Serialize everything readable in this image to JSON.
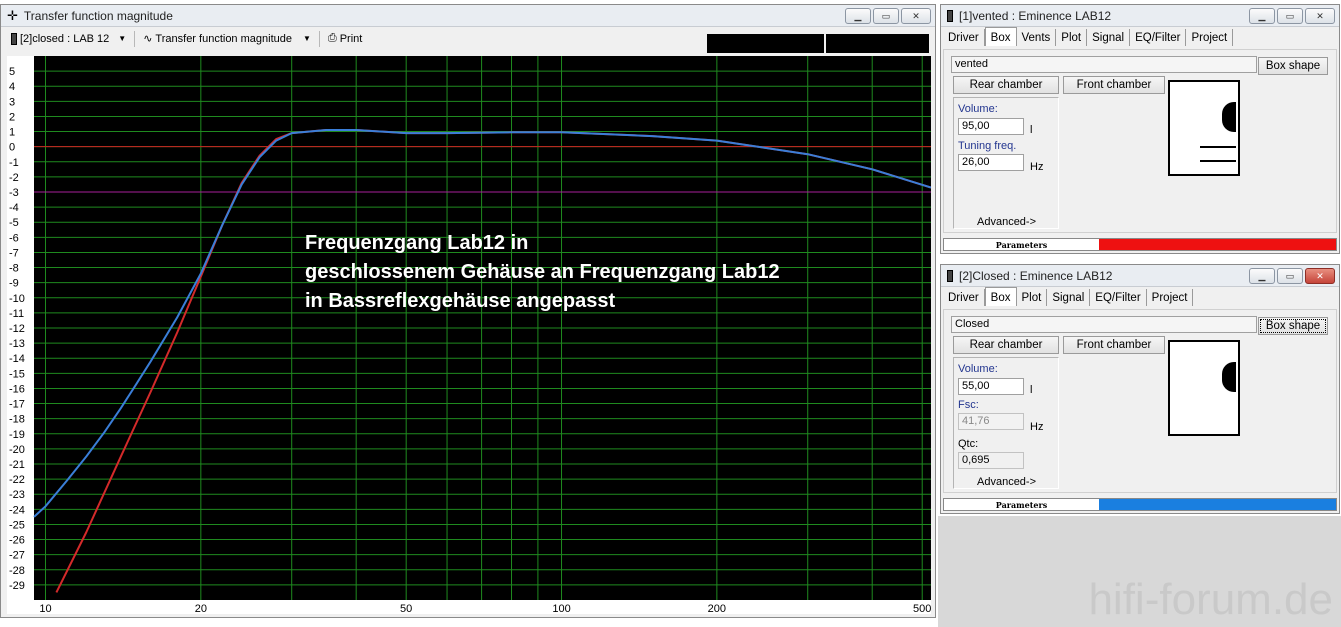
{
  "main_window": {
    "title": "Transfer function magnitude",
    "toolbar": {
      "driver_select": "[2]closed : LAB 12",
      "view_select": "Transfer function magnitude",
      "print_label": "Print"
    }
  },
  "chart_data": {
    "type": "line",
    "x_scale": "log",
    "xlim": [
      9.5,
      520
    ],
    "ylim": [
      -30,
      6
    ],
    "x_ticks": [
      "10",
      "20",
      "50",
      "100",
      "200",
      "500"
    ],
    "y_ticks": [
      "5",
      "4",
      "3",
      "2",
      "1",
      "0",
      "-1",
      "-2",
      "-3",
      "-4",
      "-5",
      "-6",
      "-7",
      "-8",
      "-9",
      "-10",
      "-11",
      "-12",
      "-13",
      "-14",
      "-15",
      "-16",
      "-17",
      "-18",
      "-19",
      "-20",
      "-21",
      "-22",
      "-23",
      "-24",
      "-25",
      "-26",
      "-27",
      "-28",
      "-29"
    ],
    "reference_lines": [
      0,
      -3
    ],
    "grid": true,
    "annotation": "Frequenzgang Lab12 in geschlossenem Gehäuse an Frequenzgang Lab12 in Bassreflexgehäuse angepasst",
    "series": [
      {
        "color": "#d42a2a",
        "x": [
          10.5,
          12,
          14,
          16,
          18,
          20,
          22,
          24,
          26,
          28,
          30,
          35,
          40,
          50,
          60,
          80,
          100,
          150,
          200,
          300,
          400,
          520
        ],
        "y": [
          -29.5,
          -25.5,
          -20.5,
          -16.2,
          -12.3,
          -8.6,
          -5.2,
          -2.4,
          -0.6,
          0.5,
          0.9,
          1.1,
          1.1,
          0.9,
          0.9,
          0.95,
          0.95,
          0.7,
          0.4,
          -0.5,
          -1.5,
          -2.7
        ]
      },
      {
        "color": "#3a7ed8",
        "x": [
          9.5,
          10,
          11,
          12,
          13,
          14,
          15,
          16,
          18,
          20,
          22,
          24,
          26,
          28,
          30,
          35,
          40,
          50,
          60,
          80,
          100,
          150,
          200,
          300,
          400,
          520
        ],
        "y": [
          -24.5,
          -23.8,
          -22.1,
          -20.5,
          -18.9,
          -17.3,
          -15.7,
          -14.2,
          -11.3,
          -8.4,
          -5.2,
          -2.5,
          -0.7,
          0.4,
          0.9,
          1.1,
          1.1,
          0.9,
          0.9,
          0.95,
          0.95,
          0.7,
          0.4,
          -0.5,
          -1.5,
          -2.7
        ]
      }
    ]
  },
  "vented_window": {
    "title": "[1]vented : Eminence LAB12",
    "tabs": [
      "Driver",
      "Box",
      "Vents",
      "Plot",
      "Signal",
      "EQ/Filter",
      "Project"
    ],
    "box_name": "vented",
    "box_shape_button": "Box shape",
    "rear_chamber_button": "Rear chamber",
    "front_chamber_button": "Front chamber",
    "volume_label": "Volume:",
    "volume_value": "95,00",
    "volume_unit": "l",
    "tuning_label": "Tuning freq.",
    "tuning_value": "26,00",
    "tuning_unit": "Hz",
    "advanced_label": "Advanced->",
    "parameters_label": "Parameters",
    "status_color": "#ee1111"
  },
  "closed_window": {
    "title": "[2]Closed : Eminence  LAB12",
    "tabs": [
      "Driver",
      "Box",
      "Plot",
      "Signal",
      "EQ/Filter",
      "Project"
    ],
    "box_name": "Closed",
    "box_shape_button": "Box shape",
    "rear_chamber_button": "Rear chamber",
    "front_chamber_button": "Front chamber",
    "volume_label": "Volume:",
    "volume_value": "55,00",
    "volume_unit": "l",
    "fsc_label": "Fsc:",
    "fsc_value": "41,76",
    "fsc_unit": "Hz",
    "qtc_label": "Qtc:",
    "qtc_value": "0,695",
    "advanced_label": "Advanced->",
    "parameters_label": "Parameters",
    "status_color": "#1a7fe0"
  },
  "watermark": "hifi-forum.de"
}
